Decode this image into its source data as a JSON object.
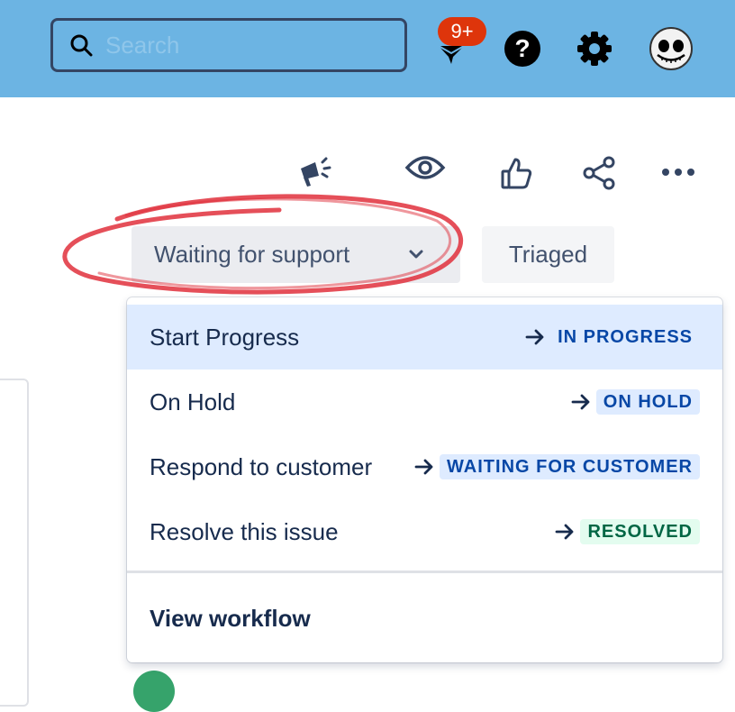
{
  "header": {
    "search_placeholder": "Search",
    "notification_count": "9+",
    "icons": [
      "search-icon",
      "notifications-icon",
      "help-icon",
      "settings-icon",
      "profile-avatar"
    ]
  },
  "issue_actions": {
    "icons": [
      "feedback-megaphone-icon",
      "watch-eye-icon",
      "vote-thumbs-up-icon",
      "share-icon",
      "more-icon"
    ]
  },
  "status": {
    "current": "Waiting for support",
    "secondary": "Triaged"
  },
  "transitions_menu": {
    "items": [
      {
        "label": "Start Progress",
        "target": "IN PROGRESS",
        "style": "plain"
      },
      {
        "label": "On Hold",
        "target": "ON HOLD",
        "style": "blue"
      },
      {
        "label": "Respond to customer",
        "target": "WAITING FOR CUSTOMER",
        "style": "blue"
      },
      {
        "label": "Resolve this issue",
        "target": "RESOLVED",
        "style": "green"
      }
    ],
    "footer_label": "View workflow"
  },
  "colors": {
    "header_bg": "#6cb4e3",
    "badge": "#de350b",
    "annotation": "#e0303c",
    "lozenge_blue": "#0747a6",
    "lozenge_green": "#006644"
  }
}
